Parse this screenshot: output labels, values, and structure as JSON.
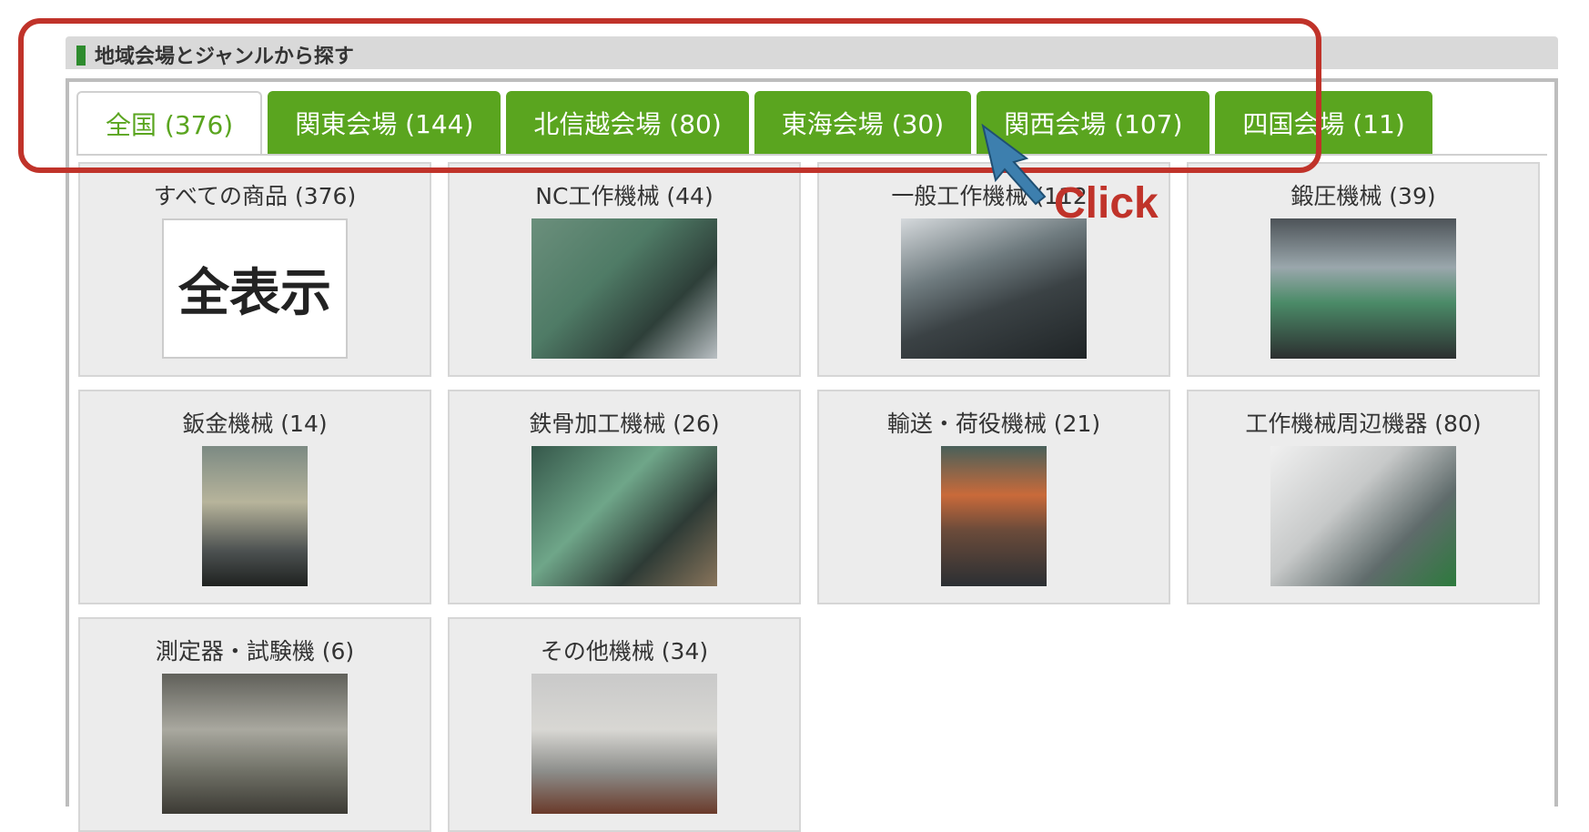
{
  "section": {
    "title": "地域会場とジャンルから探す"
  },
  "tabs": [
    {
      "label": "全国 (376)",
      "active": true
    },
    {
      "label": "関東会場 (144)"
    },
    {
      "label": "北信越会場 (80)"
    },
    {
      "label": "東海会場 (30)"
    },
    {
      "label": "関西会場 (107)"
    },
    {
      "label": "四国会場 (11)"
    }
  ],
  "categories": [
    {
      "label": "すべての商品 (376)",
      "thumb_text": "全表示"
    },
    {
      "label": "NC工作機械 (44)",
      "icon": "machine-photo"
    },
    {
      "label": "一般工作機械 (112)",
      "icon": "machine-photo"
    },
    {
      "label": "鍛圧機械 (39)",
      "icon": "machine-photo"
    },
    {
      "label": "鈑金機械 (14)",
      "icon": "machine-photo"
    },
    {
      "label": "鉄骨加工機械 (26)",
      "icon": "machine-photo"
    },
    {
      "label": "輸送・荷役機械 (21)",
      "icon": "machine-photo"
    },
    {
      "label": "工作機械周辺機器 (80)",
      "icon": "machine-photo"
    },
    {
      "label": "測定器・試験機 (6)",
      "icon": "machine-photo"
    },
    {
      "label": "その他機械 (34)",
      "icon": "machine-photo"
    }
  ],
  "annotation": {
    "click_label": "Click",
    "highlight_color": "#c0332a",
    "cursor_color": "#3d7fae"
  },
  "colors": {
    "tab_green": "#5aa51f",
    "card_bg": "#ececec"
  }
}
